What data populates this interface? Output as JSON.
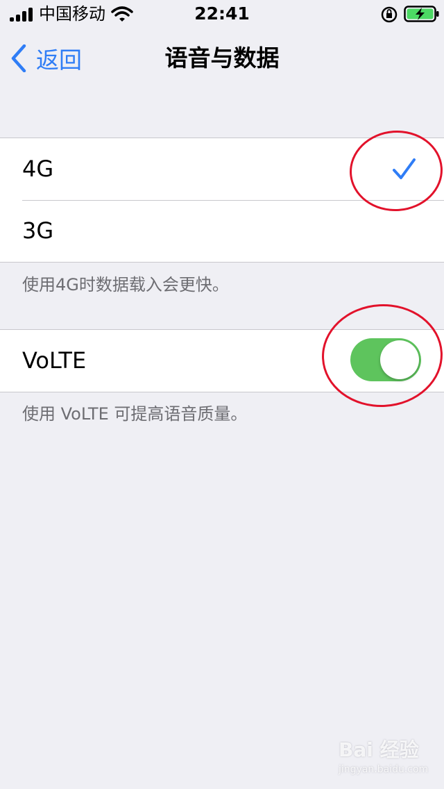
{
  "status_bar": {
    "carrier": "中国移动",
    "time": "22:41",
    "icons": [
      "signal-icon",
      "wifi-icon",
      "rotation-lock-icon",
      "battery-charging-icon"
    ]
  },
  "nav": {
    "back_label": "返回",
    "title": "语音与数据"
  },
  "network_options": [
    {
      "label": "4G",
      "selected": true
    },
    {
      "label": "3G",
      "selected": false
    }
  ],
  "network_footer": "使用4G时数据载入会更快。",
  "volte": {
    "label": "VoLTE",
    "enabled": true,
    "footer": "使用 VoLTE 可提高语音质量。"
  },
  "watermark": {
    "main": "Bai 经验",
    "sub": "jingyan.baidu.com"
  },
  "colors": {
    "accent": "#2f7df6",
    "toggle_on": "#5ec45d",
    "annotation": "#e2122b",
    "background": "#efeff4"
  }
}
